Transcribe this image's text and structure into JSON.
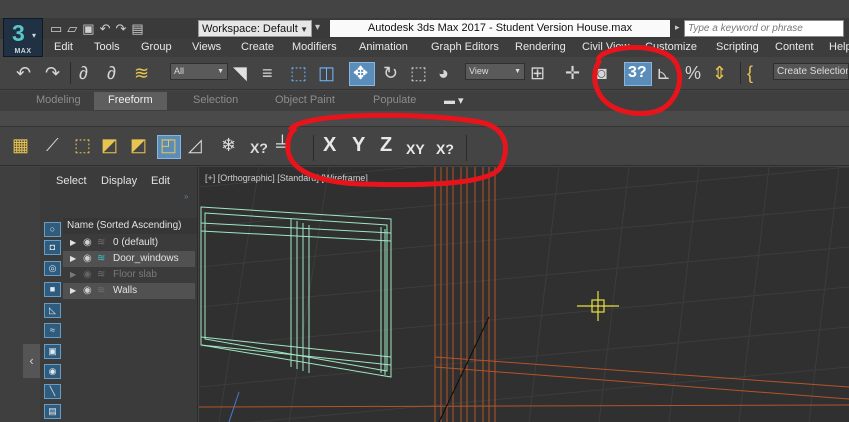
{
  "app": {
    "logo_text": "3",
    "logo_sub": "MAX",
    "workspace": "Workspace: Default",
    "title": "Autodesk 3ds Max 2017 - Student Version    House.max",
    "search_placeholder": "Type a keyword or phrase"
  },
  "menu": [
    "Edit",
    "Tools",
    "Group",
    "Views",
    "Create",
    "Modifiers",
    "Animation",
    "Graph Editors",
    "Rendering",
    "Civil View",
    "Customize",
    "Scripting",
    "Content",
    "Help"
  ],
  "toolbar": {
    "selection_filter": "All",
    "reference_coord": "View",
    "create_selection": "Create Selection Se"
  },
  "ribbon": {
    "tabs": [
      "Modeling",
      "Freeform",
      "Selection",
      "Object Paint",
      "Populate"
    ],
    "active_tab": "Freeform"
  },
  "axis_constraints": [
    "X",
    "Y",
    "Z",
    "XY",
    "X?"
  ],
  "scene_explorer": {
    "tabs": [
      "Select",
      "Display",
      "Edit"
    ],
    "column_header": "Name (Sorted Ascending)",
    "layers": [
      {
        "name": "0 (default)",
        "state": "normal"
      },
      {
        "name": "Door_windows",
        "state": "selected"
      },
      {
        "name": "Floor slab",
        "state": "hidden"
      },
      {
        "name": "Walls",
        "state": "normal"
      }
    ]
  },
  "viewport": {
    "label": "[+] [Orthographic] [Standard] [Wireframe]"
  },
  "colors": {
    "annotation": "#e8141c",
    "selected_mesh": "#9fe8c2",
    "frame": "#c0622b",
    "accent": "#5b8dbb"
  },
  "icons": [
    "undo-icon",
    "redo-icon",
    "link-icon",
    "unlink-icon",
    "bind-space-warp-icon",
    "select-object-icon",
    "select-by-name-icon",
    "rectangular-selection-icon",
    "window-crossing-icon",
    "move-icon",
    "rotate-icon",
    "scale-icon",
    "select-manipulate-icon",
    "keyboard-shortcut-icon",
    "snap-toggle-icon",
    "angle-snap-icon",
    "percent-snap-icon",
    "spinner-snap-icon",
    "edit-named-selection-icon"
  ]
}
